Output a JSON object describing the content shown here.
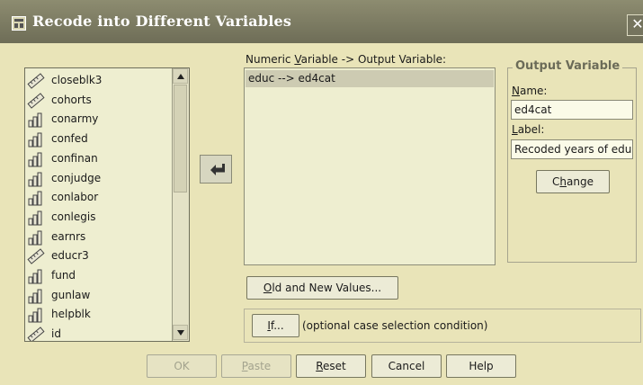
{
  "window": {
    "title": "Recode into Different Variables",
    "close_glyph": "✕"
  },
  "variables": [
    {
      "name": "closeblk3",
      "icon": "ruler-icon"
    },
    {
      "name": "cohorts",
      "icon": "ruler-icon"
    },
    {
      "name": "conarmy",
      "icon": "bar-chart-icon"
    },
    {
      "name": "confed",
      "icon": "bar-chart-icon"
    },
    {
      "name": "confinan",
      "icon": "bar-chart-icon"
    },
    {
      "name": "conjudge",
      "icon": "bar-chart-icon"
    },
    {
      "name": "conlabor",
      "icon": "bar-chart-icon"
    },
    {
      "name": "conlegis",
      "icon": "bar-chart-icon"
    },
    {
      "name": "earnrs",
      "icon": "bar-chart-icon"
    },
    {
      "name": "educr3",
      "icon": "ruler-icon"
    },
    {
      "name": "fund",
      "icon": "bar-chart-icon"
    },
    {
      "name": "gunlaw",
      "icon": "bar-chart-icon"
    },
    {
      "name": "helpblk",
      "icon": "bar-chart-icon"
    },
    {
      "name": "id",
      "icon": "ruler-icon"
    }
  ],
  "mapping": {
    "label_prefix": "Numeric ",
    "label_key": "V",
    "label_rest": "ariable -> Output Variable:",
    "items": [
      "educ --> ed4cat"
    ]
  },
  "output_variable": {
    "group_title": "Output Variable",
    "name_key": "N",
    "name_rest": "ame:",
    "name_value": "ed4cat",
    "label_key": "L",
    "label_rest": "abel:",
    "label_value": "Recoded years of education",
    "change_key": "h",
    "change_pre": "C",
    "change_rest": "ange"
  },
  "old_new": {
    "key": "O",
    "rest": "ld and New Values..."
  },
  "if_section": {
    "key": "I",
    "rest": "f...",
    "description": "(optional case selection condition)"
  },
  "buttons": {
    "ok": "OK",
    "paste_key": "P",
    "paste_rest": "aste",
    "reset_key": "R",
    "reset_rest": "eset",
    "cancel": "Cancel",
    "help": "Help"
  },
  "colors": {
    "background": "#e9e4b8",
    "titlebar": "#7d7c64",
    "selection": "#cdcbb2"
  }
}
